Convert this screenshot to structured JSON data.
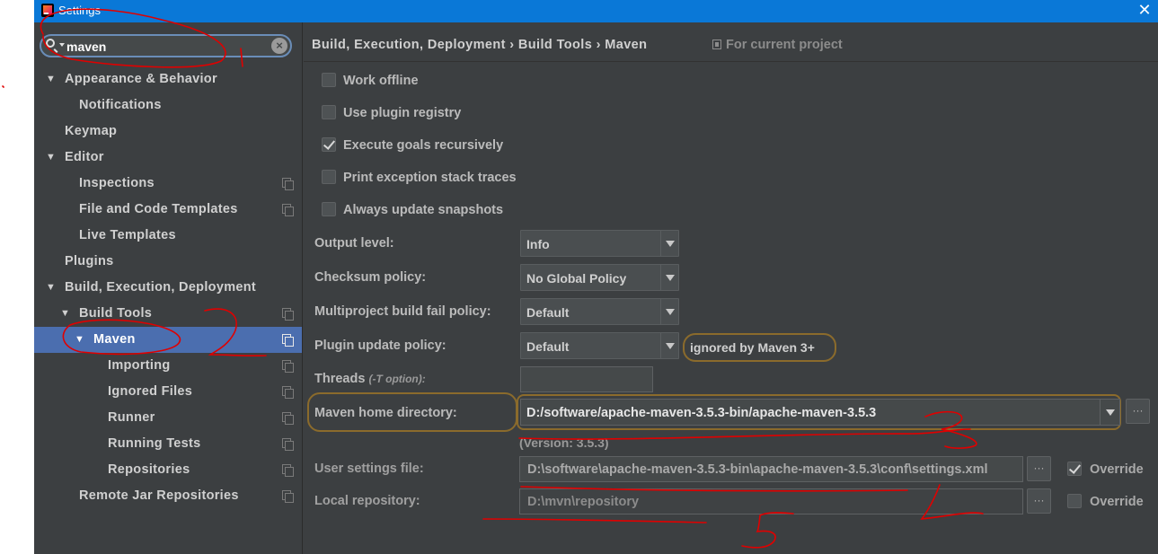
{
  "window": {
    "title": "Settings",
    "close_symbol": "✕"
  },
  "search": {
    "value": "maven",
    "clear_symbol": "×"
  },
  "sidebar": {
    "items": [
      {
        "label": "Appearance & Behavior"
      },
      {
        "label": "Notifications"
      },
      {
        "label": "Keymap"
      },
      {
        "label": "Editor"
      },
      {
        "label": "Inspections"
      },
      {
        "label": "File and Code Templates"
      },
      {
        "label": "Live Templates"
      },
      {
        "label": "Plugins"
      },
      {
        "label": "Build, Execution, Deployment"
      },
      {
        "label": "Build Tools"
      },
      {
        "label": "Maven"
      },
      {
        "label": "Importing"
      },
      {
        "label": "Ignored Files"
      },
      {
        "label": "Runner"
      },
      {
        "label": "Running Tests"
      },
      {
        "label": "Repositories"
      },
      {
        "label": "Remote Jar Repositories"
      }
    ]
  },
  "breadcrumb": {
    "path": "Build, Execution, Deployment › Build Tools › Maven",
    "scope": "For current project"
  },
  "options": {
    "work_offline": {
      "label": "Work offline",
      "checked": false
    },
    "use_plugin_registry": {
      "label": "Use plugin registry",
      "checked": false
    },
    "execute_goals_recursively": {
      "label": "Execute goals recursively",
      "checked": true
    },
    "print_exception_stack_traces": {
      "label": "Print exception stack traces",
      "checked": false
    },
    "always_update_snapshots": {
      "label": "Always update snapshots",
      "checked": false
    }
  },
  "fields": {
    "output_level": {
      "label": "Output level:",
      "value": "Info"
    },
    "checksum_policy": {
      "label": "Checksum policy:",
      "value": "No Global Policy"
    },
    "multiproject_fail_policy": {
      "label": "Multiproject build fail policy:",
      "value": "Default"
    },
    "plugin_update_policy": {
      "label": "Plugin update policy:",
      "value": "Default",
      "note": "ignored by Maven 3+"
    },
    "threads": {
      "label": "Threads",
      "hint": "(-T option):",
      "value": ""
    },
    "maven_home": {
      "label": "Maven home directory:",
      "value": "D:/software/apache-maven-3.5.3-bin/apache-maven-3.5.3",
      "version": "(Version: 3.5.3)"
    },
    "user_settings": {
      "label": "User settings file:",
      "value": "D:\\software\\apache-maven-3.5.3-bin\\apache-maven-3.5.3\\conf\\settings.xml",
      "override_label": "Override",
      "override_checked": true
    },
    "local_repository": {
      "label": "Local repository:",
      "value": "D:\\mvn\\repository",
      "override_label": "Override",
      "override_checked": false
    }
  },
  "browse_label": "···",
  "annotations": {
    "marks": [
      "1",
      "2",
      "3",
      "4",
      "5"
    ],
    "color": "#e00000"
  }
}
